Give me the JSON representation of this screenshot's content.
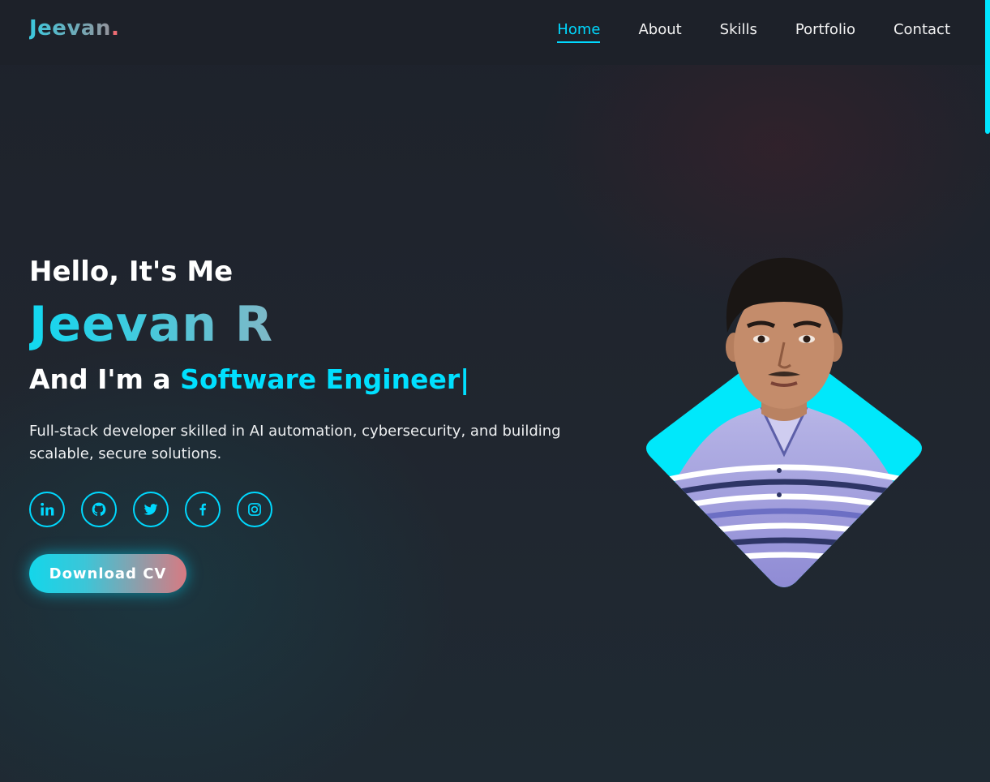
{
  "nav": {
    "logo": "Jeevan",
    "logo_dot": ".",
    "links": [
      "Home",
      "About",
      "Skills",
      "Portfolio",
      "Contact"
    ],
    "active": "Home"
  },
  "hero": {
    "greeting": "Hello, It's Me",
    "name": "Jeevan R",
    "role_prefix": "And I'm a ",
    "role": "Software Engineer",
    "cursor": "|",
    "description": "Full-stack developer skilled in AI automation, cybersecurity, and building scalable, secure solutions.",
    "cv_button": "Download CV"
  },
  "socials": [
    "linkedin-icon",
    "github-icon",
    "twitter-icon",
    "facebook-icon",
    "instagram-icon"
  ],
  "colors": {
    "accent": "#00d9ff",
    "background": "#1e222b",
    "logo_dot": "#f06b72"
  }
}
